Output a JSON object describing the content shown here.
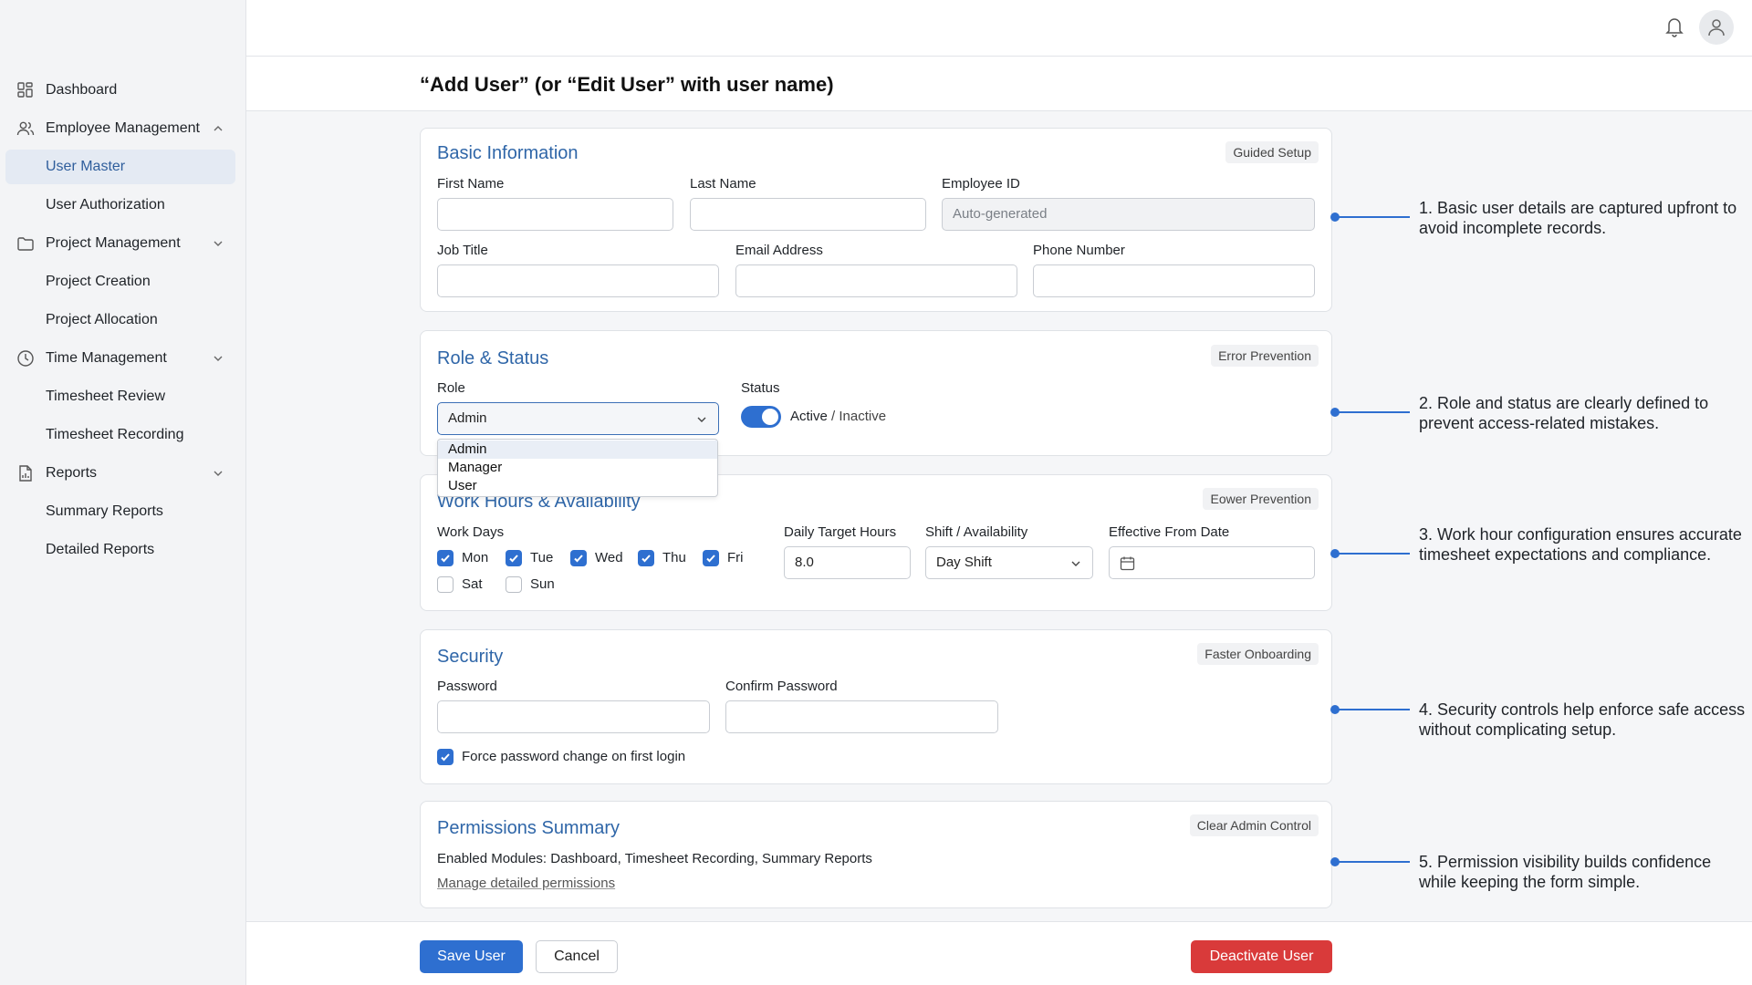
{
  "sidebar": {
    "items": [
      {
        "label": "Dashboard"
      },
      {
        "label": "Employee Management"
      },
      {
        "label": "User Master"
      },
      {
        "label": "User Authorization"
      },
      {
        "label": "Project Management"
      },
      {
        "label": "Project Creation"
      },
      {
        "label": "Project Allocation"
      },
      {
        "label": "Time Management"
      },
      {
        "label": "Timesheet Review"
      },
      {
        "label": "Timesheet Recording"
      },
      {
        "label": "Reports"
      },
      {
        "label": "Summary Reports"
      },
      {
        "label": "Detailed Reports"
      }
    ]
  },
  "header": {
    "page_title": "“Add User” (or “Edit User” with user name)"
  },
  "basic": {
    "title": "Basic Information",
    "badge": "Guided Setup",
    "first_name_label": "First Name",
    "last_name_label": "Last Name",
    "employee_id_label": "Employee ID",
    "employee_id_placeholder": "Auto-generated",
    "job_title_label": "Job Title",
    "email_label": "Email Address",
    "phone_label": "Phone Number"
  },
  "role": {
    "title": "Role & Status",
    "badge": "Error Prevention",
    "role_label": "Role",
    "role_value": "Admin",
    "options": [
      "Admin",
      "Manager",
      "User"
    ],
    "status_label": "Status",
    "status_active": "Active",
    "status_sep": " / ",
    "status_inactive": "Inactive"
  },
  "work": {
    "title": "Work Hours & Availability",
    "badge": "Eower Prevention",
    "days_label": "Work Days",
    "days": [
      {
        "label": "Mon",
        "checked": true
      },
      {
        "label": "Tue",
        "checked": true
      },
      {
        "label": "Wed",
        "checked": true
      },
      {
        "label": "Thu",
        "checked": true
      },
      {
        "label": "Fri",
        "checked": true
      },
      {
        "label": "Sat",
        "checked": false
      },
      {
        "label": "Sun",
        "checked": false
      }
    ],
    "target_label": "Daily Target Hours",
    "target_value": "8.0",
    "shift_label": "Shift / Availability",
    "shift_value": "Day Shift",
    "effective_label": "Effective From Date"
  },
  "security": {
    "title": "Security",
    "badge": "Faster Onboarding",
    "password_label": "Password",
    "confirm_label": "Confirm Password",
    "force_change_label": "Force password change on first login"
  },
  "permissions": {
    "title": "Permissions Summary",
    "badge": "Clear Admin Control",
    "enabled_text": "Enabled Modules: Dashboard, Timesheet Recording, Summary Reports",
    "manage_link": "Manage detailed permissions"
  },
  "footer": {
    "save_label": "Save User",
    "cancel_label": "Cancel",
    "deactivate_label": "Deactivate User"
  },
  "annotations": [
    "1. Basic user details are captured upfront to avoid incomplete records.",
    "2. Role and status are clearly defined to prevent access-related mistakes.",
    "3. Work hour configuration ensures accurate timesheet expectations and compliance.",
    "4. Security controls help enforce safe access without complicating setup.",
    "5. Permission visibility builds confidence while keeping the form simple."
  ],
  "colors": {
    "accent": "#2e6fd0",
    "section_title": "#2f66a8",
    "danger": "#d93a3a",
    "active_nav_bg": "#e4eaf3"
  }
}
